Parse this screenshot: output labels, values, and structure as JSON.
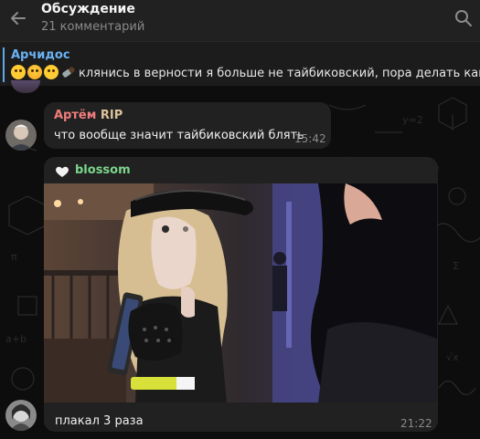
{
  "header": {
    "title": "Обсуждение",
    "subtitle": "21 комментарий"
  },
  "pinned": {
    "author": "Арчидос",
    "text": "клянись в верности я больше не тайбиковский, пора делать каминг-аут"
  },
  "messages": [
    {
      "author": "Артём",
      "author_suffix": "RIP",
      "text": "что вообще значит тайбиковский блять",
      "time": "15:42"
    },
    {
      "author": "blossom",
      "caption": "плакал 3 раза",
      "time": "21:22"
    }
  ],
  "colors": {
    "header_bg": "#212121",
    "bubble_bg": "#212121",
    "accent_blue": "#6ab3f3",
    "name_red": "#f07d7d",
    "name_green": "#7cd68b"
  },
  "icons": {
    "back": "arrow-left-icon",
    "search": "search-icon",
    "heart": "white-heart-icon"
  }
}
